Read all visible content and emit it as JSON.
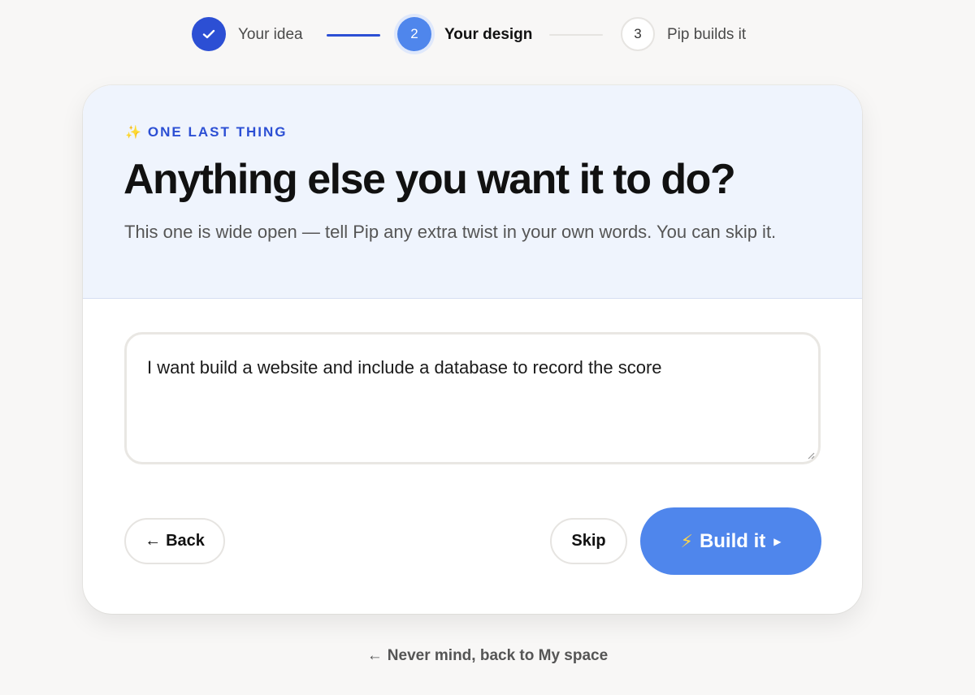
{
  "stepper": {
    "steps": [
      {
        "number": "✓",
        "label": "Your idea",
        "state": "done"
      },
      {
        "number": "2",
        "label": "Your design",
        "state": "active"
      },
      {
        "number": "3",
        "label": "Pip builds it",
        "state": "todo"
      }
    ]
  },
  "card": {
    "eyebrow": "ONE LAST THING",
    "eyebrow_icon": "sparkle-icon",
    "title": "Anything else you want it to do?",
    "subtitle": "This one is wide open — tell Pip any extra twist in your own words. You can skip it.",
    "answer": "I want build a website and include a database to record the score",
    "buttons": {
      "back": "Back",
      "skip": "Skip",
      "build": "Build it"
    }
  },
  "footer": {
    "back_link": "Never mind, back to My space"
  },
  "colors": {
    "primary": "#2c4fd4",
    "accent": "#4f86ec",
    "header_bg": "#eff4fd",
    "page_bg": "#f8f7f6"
  }
}
